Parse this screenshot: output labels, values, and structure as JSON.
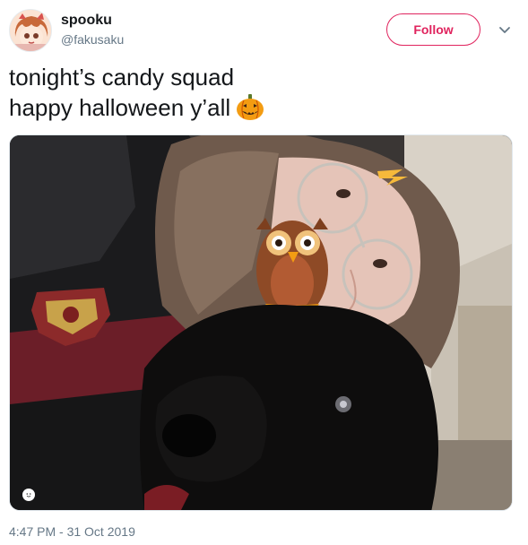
{
  "user": {
    "display_name": "spooku",
    "handle": "@fakusaku"
  },
  "follow_button": {
    "label": "Follow"
  },
  "tweet": {
    "lines": [
      "tonight’s candy squad",
      "happy halloween y’all"
    ],
    "emoji_icon": "jack-o-lantern-icon",
    "timestamp": "4:47 PM - 31 Oct 2019"
  },
  "media": {
    "description_icons": [
      "owl-sticker-icon",
      "lightning-scar-icon",
      "gryffindor-crest-icon"
    ]
  },
  "colors": {
    "accent": "#e0245e",
    "secondary_text": "#657786",
    "primary_text": "#14171a"
  }
}
